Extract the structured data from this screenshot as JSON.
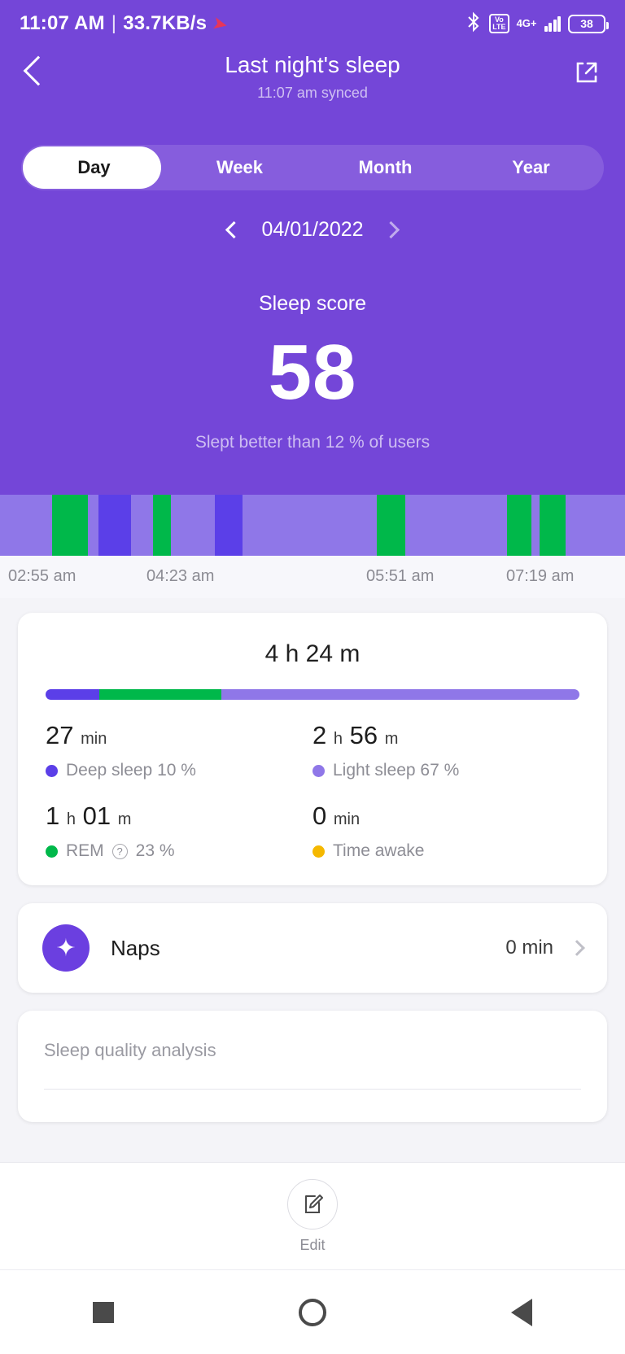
{
  "status_bar": {
    "time": "11:07 AM",
    "separator": "|",
    "network_speed": "33.7KB/s",
    "rocket_icon": "rocket-icon",
    "bluetooth_icon": "bluetooth-icon",
    "volte_top": "Vo",
    "volte_bottom": "LTE",
    "network_type": "4G+",
    "battery_level": "38"
  },
  "header": {
    "back_icon": "back-chevron-icon",
    "title": "Last night's sleep",
    "subtitle": "11:07 am synced",
    "share_icon": "share-external-icon"
  },
  "tabs": {
    "items": [
      {
        "label": "Day",
        "active": true
      },
      {
        "label": "Week",
        "active": false
      },
      {
        "label": "Month",
        "active": false
      },
      {
        "label": "Year",
        "active": false
      }
    ]
  },
  "date_nav": {
    "prev_icon": "chevron-left-icon",
    "date": "04/01/2022",
    "next_icon": "chevron-right-icon"
  },
  "sleep_score": {
    "label": "Sleep score",
    "value": "58",
    "comparison": "Slept better than 12 % of users"
  },
  "colors": {
    "header_purple": "#7446d8",
    "deep_sleep": "#5b3fe8",
    "light_sleep": "#8f77e8",
    "rem": "#00b84a",
    "awake": "#f5b800",
    "accent": "#6b3fe0"
  },
  "chart_data": {
    "type": "bar",
    "title": "Sleep stages hypnogram",
    "xlabel": "",
    "ylabel": "",
    "grid": false,
    "legend_position": "below-card",
    "x_tick_labels": [
      "02:55 am",
      "04:23 am",
      "05:51 am",
      "07:19 am"
    ],
    "x_range": [
      "02:55 am",
      "07:19 am"
    ],
    "categories": [
      "Light sleep",
      "REM",
      "Deep sleep",
      "Time awake"
    ],
    "stage_colors": {
      "Light sleep": "#8f77e8",
      "REM": "#00b84a",
      "Deep sleep": "#5b3fe8",
      "Time awake": "#f5b800"
    },
    "segments": [
      {
        "stage": "Light sleep",
        "width_pct": 8.3
      },
      {
        "stage": "REM",
        "width_pct": 5.7
      },
      {
        "stage": "Light sleep",
        "width_pct": 1.8
      },
      {
        "stage": "Deep sleep",
        "width_pct": 5.2
      },
      {
        "stage": "Light sleep",
        "width_pct": 3.5
      },
      {
        "stage": "REM",
        "width_pct": 2.9
      },
      {
        "stage": "Light sleep",
        "width_pct": 7.0
      },
      {
        "stage": "Deep sleep",
        "width_pct": 4.4
      },
      {
        "stage": "Light sleep",
        "width_pct": 21.5
      },
      {
        "stage": "REM",
        "width_pct": 4.6
      },
      {
        "stage": "Light sleep",
        "width_pct": 16.2
      },
      {
        "stage": "REM",
        "width_pct": 3.9
      },
      {
        "stage": "Light sleep",
        "width_pct": 1.3
      },
      {
        "stage": "REM",
        "width_pct": 4.2
      },
      {
        "stage": "Light sleep",
        "width_pct": 9.5
      }
    ],
    "summary": {
      "total_duration": "4 h 24 m",
      "proportions": [
        {
          "stage": "Deep sleep",
          "percent": 10
        },
        {
          "stage": "REM",
          "percent": 23
        },
        {
          "stage": "Light sleep",
          "percent": 67
        }
      ]
    }
  },
  "summary_card": {
    "total": "4 h 24 m",
    "stats": [
      {
        "value": "27",
        "unit": "min",
        "value2": "",
        "unit2": "",
        "legend": "Deep sleep 10 %",
        "dot": "#5b3fe8",
        "has_help": false
      },
      {
        "value": "2",
        "unit": "h",
        "value2": "56",
        "unit2": "m",
        "legend": "Light sleep 67 %",
        "dot": "#8f77e8",
        "has_help": false
      },
      {
        "value": "1",
        "unit": "h",
        "value2": "01",
        "unit2": "m",
        "legend": "REM",
        "legend_suffix": "23 %",
        "dot": "#00b84a",
        "has_help": true,
        "help_icon": "question-mark-icon"
      },
      {
        "value": "0",
        "unit": "min",
        "value2": "",
        "unit2": "",
        "legend": "Time awake",
        "dot": "#f5b800",
        "has_help": false
      }
    ]
  },
  "naps_card": {
    "icon": "sparkle-nap-icon",
    "label": "Naps",
    "value": "0 min",
    "chevron": "chevron-right-icon"
  },
  "sleep_quality": {
    "title": "Sleep quality analysis"
  },
  "edit_bar": {
    "icon": "edit-note-icon",
    "label": "Edit"
  },
  "android_nav": {
    "recents": "square-recents-icon",
    "home": "circle-home-icon",
    "back": "triangle-back-icon"
  }
}
